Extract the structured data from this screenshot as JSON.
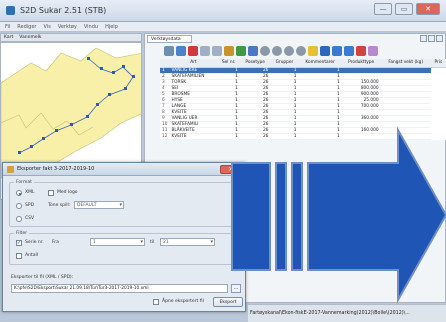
{
  "window": {
    "title": "S2D Sukar 2.51 (STB)",
    "min": "—",
    "max": "▭",
    "close": "✕"
  },
  "menu": [
    "Fil",
    "Rediger",
    "Vis",
    "Verktøy",
    "Vindu",
    "Hjelp"
  ],
  "map_pane": {
    "tab": "Kart",
    "subtab": "Vannmelk"
  },
  "table_pane": {
    "tab": "Verktøysdata",
    "columns": [
      "",
      "Art",
      "Sel nr.",
      "Posetype",
      "Grupper",
      "Kommentarer",
      "Produkttype",
      "Fangst vekt (kg)",
      "Pris"
    ],
    "rows": [
      [
        "1",
        "VANLIG KRE",
        "1",
        "26",
        "1",
        "1",
        "",
        ""
      ],
      [
        "2",
        "SKATEFAMILIEN",
        "1",
        "26",
        "1",
        "1",
        "",
        ""
      ],
      [
        "3",
        "TORSK",
        "1",
        "26",
        "1",
        "1",
        "150.000",
        ""
      ],
      [
        "4",
        "SEI",
        "1",
        "26",
        "1",
        "1",
        "800.000",
        ""
      ],
      [
        "5",
        "BROSME",
        "1",
        "26",
        "1",
        "1",
        "900.000",
        ""
      ],
      [
        "6",
        "HYSE",
        "1",
        "26",
        "1",
        "1",
        "25.000",
        ""
      ],
      [
        "7",
        "LANGE",
        "1",
        "26",
        "1",
        "1",
        "700.000",
        ""
      ],
      [
        "8",
        "KVEITE",
        "1",
        "26",
        "1",
        "1",
        "",
        ""
      ],
      [
        "9",
        "VANLIG UER",
        "1",
        "26",
        "1",
        "1",
        "360.000",
        ""
      ],
      [
        "10",
        "SKATEFAMILI",
        "1",
        "26",
        "1",
        "1",
        "",
        ""
      ],
      [
        "11",
        "BLÅKVEITE",
        "1",
        "26",
        "1",
        "1",
        "160.000",
        ""
      ],
      [
        "12",
        "KVEITE",
        "1",
        "26",
        "1",
        "1",
        "",
        ""
      ]
    ],
    "selected_row": 0
  },
  "dialog": {
    "title": "Eksporter fakt 3-2017-2019-10",
    "close": "✕",
    "format_label": "Format",
    "formats": [
      "XML",
      "SPD",
      "CSV"
    ],
    "selected_format": "XML",
    "med_logo_label": "Med logo",
    "tone_label": "Tone spill:",
    "tone_value": "DEFAULT",
    "filter_label": "Filter",
    "serie_label": "Serie nr.",
    "fra_label": "Fra",
    "fra_value": "1",
    "til_label": "til",
    "til_value": "21",
    "annet_label": "Antall",
    "export_path_label": "Eksporter til fil (XML / SPD):",
    "export_path": "K:\\pfe\\S2D\\Eksport\\Sukar 21.09.18\\Tur\\Tur3-2017-2019-10.xml",
    "browse": "...",
    "open_after_label": "Åpne eksportert fil",
    "export_button": "Eksport"
  },
  "statusbar": {
    "text": "Fartøyskanal\\Ekon-fiskE-2017-Vannemarking(2012)\\Bolle\\(2012)\\..."
  },
  "colors": {
    "accent": "#1e4fa8",
    "arrow_fill": "#1f55b5",
    "arrow_stroke": "#6f8fc8",
    "map_land": "#f8f0a8"
  }
}
